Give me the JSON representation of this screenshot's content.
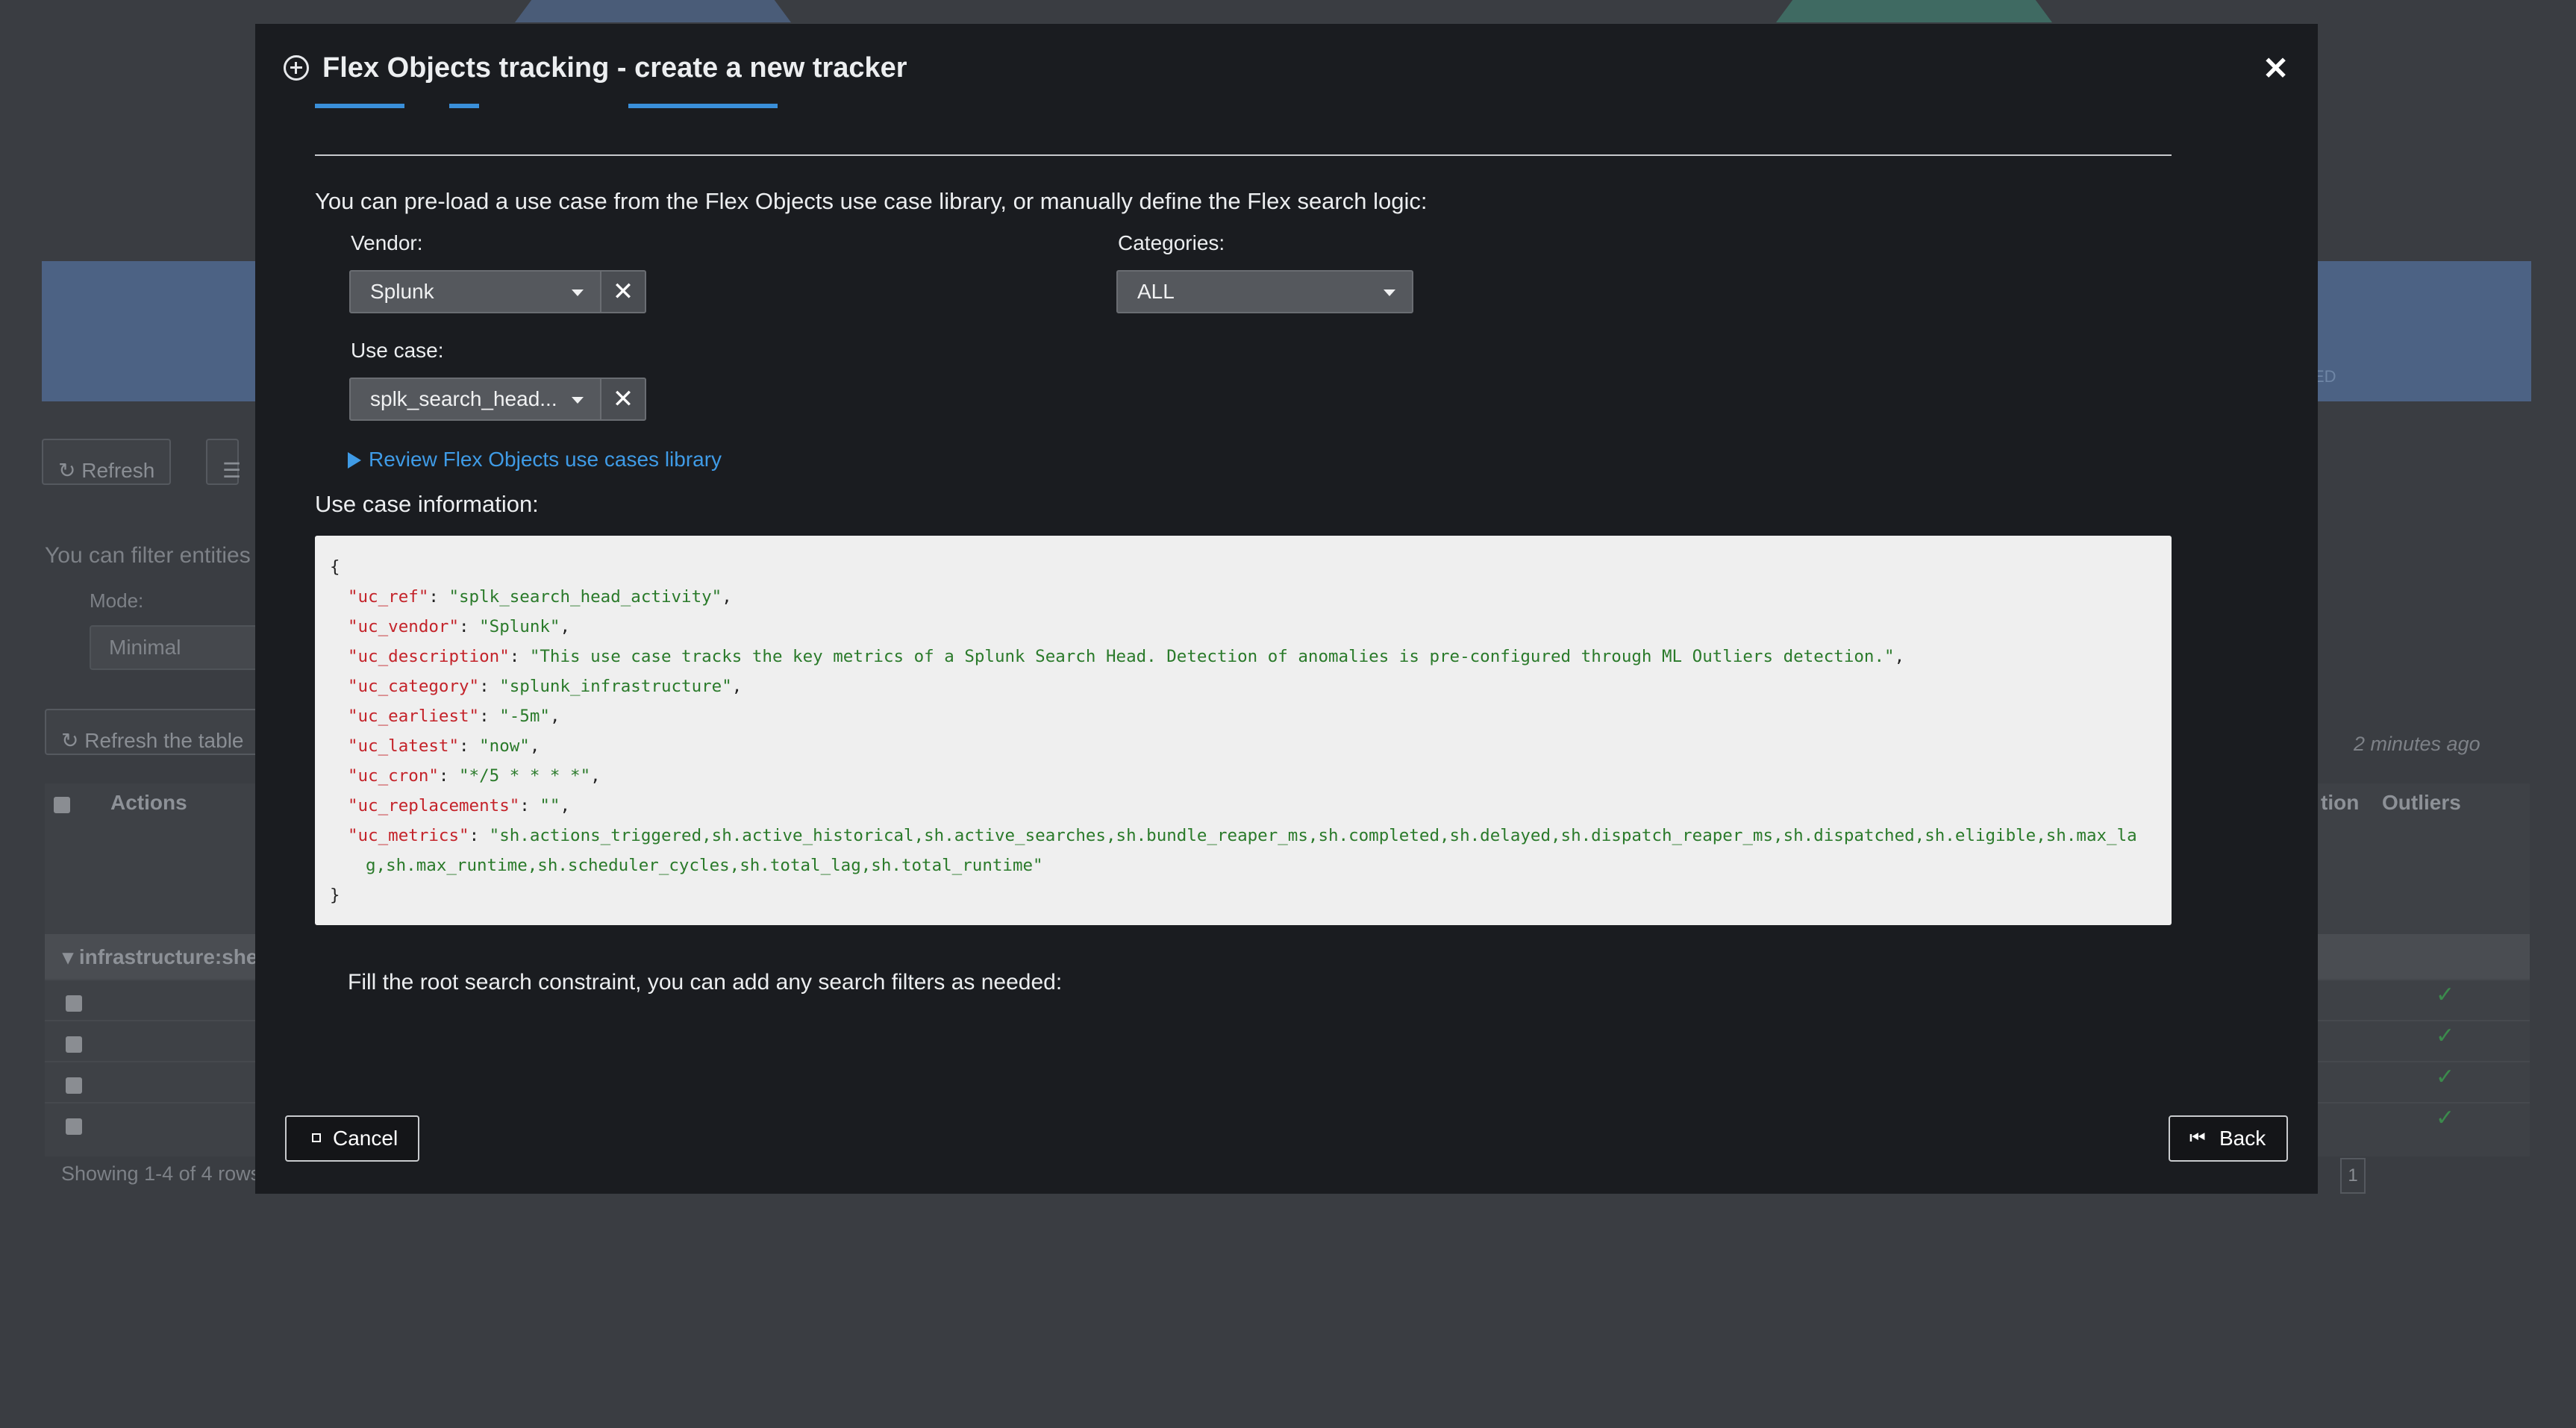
{
  "background": {
    "refresh_label": "Refresh",
    "filter_text": "You can filter entities",
    "mode_label": "Mode:",
    "mode_value": "Minimal",
    "refresh_table_label": "Refresh the table",
    "updated_ago": "2 minutes ago",
    "actions_header": "Actions",
    "outliers_header": "Outliers",
    "partial_header": "tion",
    "group_row_label": "infrastructure:she",
    "showing_rows": "Showing 1-4 of 4 rows",
    "page_number": "1",
    "banner_fragment": "ED"
  },
  "modal": {
    "title": "Flex Objects tracking - create a new tracker",
    "intro_text": "You can pre-load a use case from the Flex Objects use case library, or manually define the Flex search logic:",
    "vendor": {
      "label": "Vendor:",
      "value": "Splunk"
    },
    "categories": {
      "label": "Categories:",
      "value": "ALL"
    },
    "use_case": {
      "label": "Use case:",
      "value": "splk_search_head..."
    },
    "review_link": "Review Flex Objects use cases library",
    "use_case_info_label": "Use case information:",
    "use_case_json": {
      "open": "{",
      "close": "}",
      "lines": [
        {
          "key": "\"uc_ref\"",
          "value": "\"splk_search_head_activity\"",
          "end": ","
        },
        {
          "key": "\"uc_vendor\"",
          "value": "\"Splunk\"",
          "end": ","
        },
        {
          "key": "\"uc_description\"",
          "value": "\"This use case tracks the key metrics of a Splunk Search Head. Detection of anomalies is pre-configured through ML Outliers detection.\"",
          "end": ","
        },
        {
          "key": "\"uc_category\"",
          "value": "\"splunk_infrastructure\"",
          "end": ","
        },
        {
          "key": "\"uc_earliest\"",
          "value": "\"-5m\"",
          "end": ","
        },
        {
          "key": "\"uc_latest\"",
          "value": "\"now\"",
          "end": ","
        },
        {
          "key": "\"uc_cron\"",
          "value": "\"*/5 * * * *\"",
          "end": ","
        },
        {
          "key": "\"uc_replacements\"",
          "value": "\"\"",
          "end": ","
        },
        {
          "key": "\"uc_metrics\"",
          "value": "\"sh.actions_triggered,sh.active_historical,sh.active_searches,sh.bundle_reaper_ms,sh.completed,sh.delayed,sh.dispatch_reaper_ms,sh.dispatched,sh.eligible,sh.max_lag,sh.max_runtime,sh.scheduler_cycles,sh.total_lag,sh.total_runtime\"",
          "end": ""
        }
      ]
    },
    "root_search_text": "Fill the root search constraint, you can add any search filters as needed:",
    "cancel_label": "Cancel",
    "back_label": "Back"
  }
}
